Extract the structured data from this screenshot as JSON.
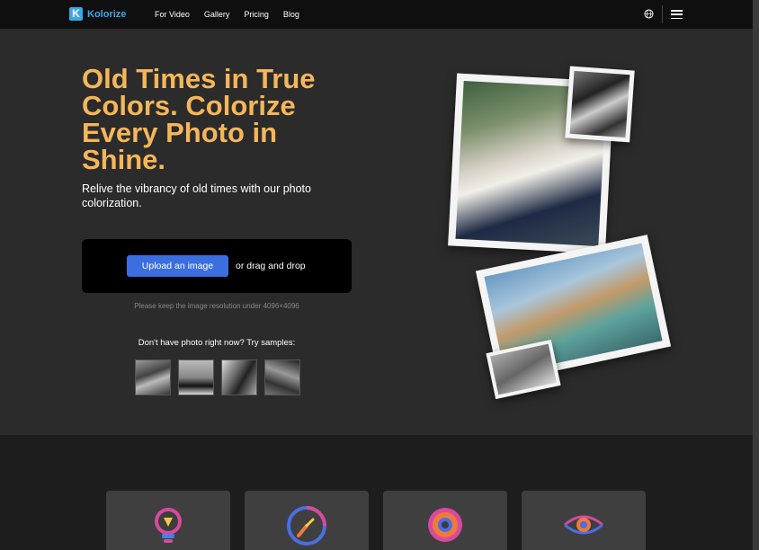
{
  "nav": {
    "logo_letter": "K",
    "logo_text": "Kolorize",
    "links": [
      "For Video",
      "Gallery",
      "Pricing",
      "Blog"
    ],
    "globe_icon": "globe-icon",
    "menu_icon": "hamburger-menu-icon"
  },
  "hero": {
    "title": "Old Times in True Colors. Colorize Every Photo in Shine.",
    "subtitle": "Relive the vibrancy of old times with our photo colorization.",
    "upload_label": "Upload an image",
    "drag_text": "or drag and drop",
    "note": "Please keep the image resolution under 4096×4096",
    "samples_title": "Don't have photo right now? Try samples:"
  },
  "features": {
    "icons": [
      "lightbulb-icon",
      "timer-icon",
      "gear-icon",
      "eye-icon"
    ]
  },
  "colors": {
    "accent": "#f5b65a",
    "brand": "#3aa6e8",
    "button": "#3b6fe0"
  }
}
